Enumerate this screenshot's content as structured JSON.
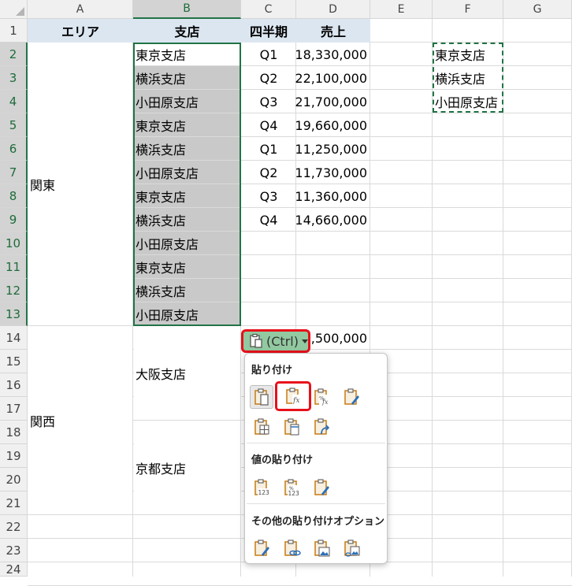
{
  "columns": [
    "A",
    "B",
    "C",
    "D",
    "E",
    "F",
    "G"
  ],
  "rows": [
    "1",
    "2",
    "3",
    "4",
    "5",
    "6",
    "7",
    "8",
    "9",
    "10",
    "11",
    "12",
    "13",
    "14",
    "15",
    "16",
    "17",
    "18",
    "19",
    "20",
    "21",
    "22",
    "23",
    "24"
  ],
  "table_headers": {
    "area": "エリア",
    "branch": "支店",
    "quarter": "四半期",
    "sales": "売上"
  },
  "regions": {
    "kanto": "関東",
    "kansai": "関西"
  },
  "branches_b": [
    "東京支店",
    "横浜支店",
    "小田原支店",
    "東京支店",
    "横浜支店",
    "小田原支店",
    "東京支店",
    "横浜支店",
    "小田原支店",
    "東京支店",
    "横浜支店",
    "小田原支店"
  ],
  "quarters_c": [
    "Q1",
    "Q2",
    "Q3",
    "Q4",
    "Q1",
    "Q2",
    "Q3",
    "Q4"
  ],
  "sales_d": [
    "18,330,000",
    "22,100,000",
    "21,700,000",
    "19,660,000",
    "11,250,000",
    "11,730,000",
    "11,360,000",
    "14,660,000"
  ],
  "d14_value": "6,500,000",
  "kansai_branches": {
    "osaka": "大阪支店",
    "kyoto": "京都支店"
  },
  "copied_f": [
    "東京支店",
    "横浜支店",
    "小田原支店"
  ],
  "paste_button": {
    "label": "(Ctrl)"
  },
  "paste_menu": {
    "section1": "貼り付け",
    "section2": "値の貼り付け",
    "section3": "その他の貼り付けオプション",
    "icon_labels": {
      "values": "123",
      "fx": "fx",
      "percent": "%"
    }
  },
  "colors": {
    "accent": "#217346",
    "highlight": "#e8101a",
    "header_fill": "#dce6f1",
    "selection_fill": "#c9c9c9"
  }
}
